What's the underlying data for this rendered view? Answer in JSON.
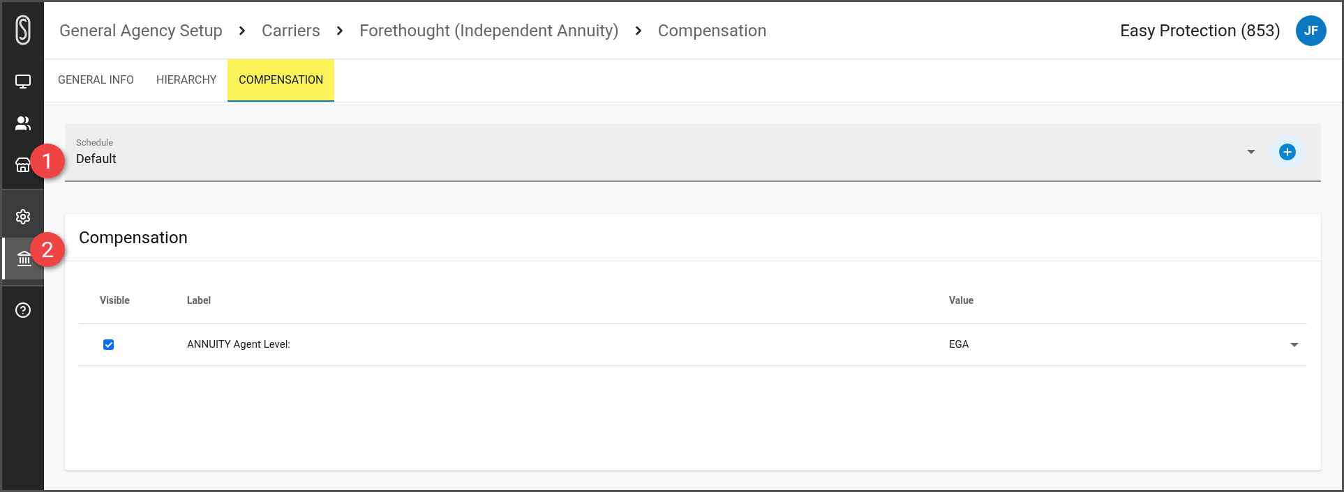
{
  "sidebar": {
    "sections": [
      {
        "items": [
          {
            "kind": "monitor",
            "selected": false
          },
          {
            "kind": "people",
            "selected": false
          },
          {
            "kind": "store",
            "selected": false
          }
        ]
      },
      {
        "items": [
          {
            "kind": "gear",
            "selected": false
          },
          {
            "kind": "bank",
            "selected": true
          }
        ]
      },
      {
        "items": [
          {
            "kind": "help",
            "selected": false
          }
        ]
      }
    ]
  },
  "breadcrumb": [
    "General Agency Setup",
    "Carriers",
    "Forethought (Independent Annuity)",
    "Compensation"
  ],
  "agency": "Easy Protection (853)",
  "avatar": "JF",
  "tabs": [
    {
      "label": "GENERAL INFO",
      "selected": false
    },
    {
      "label": "HIERARCHY",
      "selected": false
    },
    {
      "label": "COMPENSATION",
      "selected": true
    }
  ],
  "schedule": {
    "label": "Schedule",
    "value": "Default"
  },
  "card": {
    "title": "Compensation",
    "columns": [
      "Visible",
      "Label",
      "Value"
    ],
    "rows": [
      {
        "checked": true,
        "label": "ANNUITY Agent Level:",
        "value": "EGA"
      }
    ]
  },
  "callouts": [
    "1",
    "2"
  ]
}
